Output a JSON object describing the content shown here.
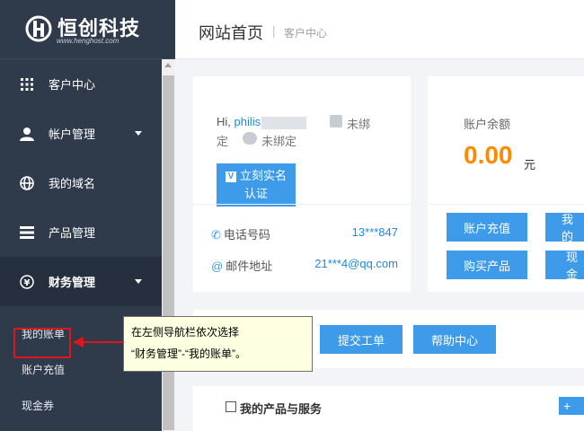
{
  "brand": {
    "name": "恒创科技",
    "url": "www.henghost.com",
    "accent": "#3d9be9",
    "sidebar_bg": "#2f3a4b"
  },
  "sidebar": {
    "items": [
      {
        "label": "客户中心",
        "icon": "grid-icon"
      },
      {
        "label": "帐户管理",
        "icon": "user-icon"
      },
      {
        "label": "我的域名",
        "icon": "globe-icon"
      },
      {
        "label": "产品管理",
        "icon": "server-icon"
      },
      {
        "label": "财务管理",
        "icon": "yen-icon"
      }
    ],
    "sub_items": [
      {
        "label": "我的账单"
      },
      {
        "label": "账户充值"
      },
      {
        "label": "现金券"
      }
    ]
  },
  "header": {
    "title": "网站首页",
    "separator": "|",
    "breadcrumb": "客户中心"
  },
  "user_card": {
    "greeting": "Hi, ",
    "username": "philis",
    "phone_status_a": "未绑",
    "phone_status_b": "定",
    "wechat_status": "未绑定",
    "verify_button": "立刻实名认证",
    "phone_label": "电话号码",
    "phone_value": "13***847",
    "email_label": "邮件地址",
    "email_value": "21***4@qq.com"
  },
  "balance_card": {
    "label": "账户余额",
    "amount": "0.00",
    "unit": "元",
    "recharge_button": "账户充值",
    "my_button": "我的",
    "buy_button": "购买产品",
    "cash_button": "现金"
  },
  "actions": {
    "ticket_button": "提交工单",
    "help_button": "帮助中心"
  },
  "products": {
    "title": "我的产品与服务",
    "add_label": "+ 查"
  },
  "annotation": {
    "line1": "在左侧导航栏依次选择",
    "line2": "“财务管理”-“我的账单”。",
    "color": "#e0151b"
  }
}
